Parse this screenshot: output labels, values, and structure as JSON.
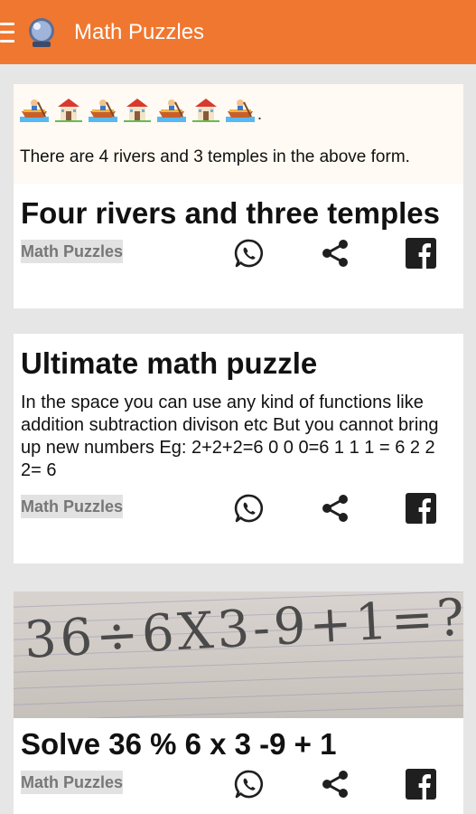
{
  "app": {
    "title": "Math Puzzles",
    "accent": "#f0772f",
    "icons": [
      "menu-icon",
      "app-logo-icon"
    ]
  },
  "cards": [
    {
      "emoji_sequence": [
        "boat",
        "temple",
        "boat",
        "temple",
        "boat",
        "temple",
        "boat"
      ],
      "emoji_caption": "There are 4 rivers and 3 temples in the above form.",
      "title": "Four rivers and three temples",
      "category": "Math Puzzles"
    },
    {
      "title": "Ultimate math puzzle",
      "body": "In the space you can use any kind of functions like addition subtraction divison etc But you cannot bring up new numbers Eg: 2+2+2=6 0 0 0=6 1 1 1 = 6 2 2 2= 6",
      "category": "Math Puzzles"
    },
    {
      "photo_text": "36÷6X3-9+1=?",
      "title": "Solve 36 % 6 x 3 -9 + 1",
      "category": "Math Puzzles"
    }
  ],
  "actions": {
    "whatsapp_color": "#1f1f1f",
    "share_color": "#1f1f1f",
    "facebook_color": "#1f1f1f"
  }
}
